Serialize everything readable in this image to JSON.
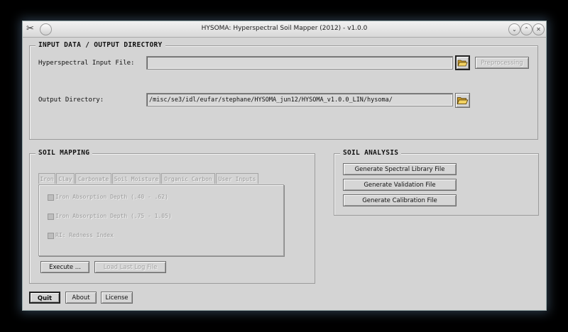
{
  "window": {
    "title": "HYSOMA: Hyperspectral Soil Mapper (2012) - v1.0.0"
  },
  "input_output": {
    "group_title": "INPUT DATA / OUTPUT DIRECTORY",
    "input_label": "Hyperspectral Input File:",
    "input_value": "",
    "preprocessing_label": "Preprocessing",
    "output_label": "Output Directory:",
    "output_value": "/misc/se3/idl/eufar/stephane/HYSOMA_jun12/HYSOMA_v1.0.0_LIN/hysoma/"
  },
  "soil_mapping": {
    "group_title": "SOIL MAPPING",
    "tabs": [
      "Iron",
      "Clay",
      "Carbonate",
      "Soil Moisture",
      "Organic Carbon",
      "User Inputs"
    ],
    "options": [
      "Iron Absorption Depth (.40 - .62)",
      "Iron Absorption Depth (.75 - 1.05)",
      "RI: Redness Index"
    ],
    "execute_label": "Execute ...",
    "load_log_label": "Load Last Log File"
  },
  "soil_analysis": {
    "group_title": "SOIL ANALYSIS",
    "buttons": [
      "Generate Spectral Library File",
      "Generate Validation File",
      "Generate Calibration File"
    ]
  },
  "footer": {
    "quit": "Quit",
    "about": "About",
    "license": "License"
  },
  "icons": [
    "app-tools-icon",
    "menu-icon",
    "minimize-icon",
    "maximize-icon",
    "close-icon",
    "folder-open-icon"
  ]
}
